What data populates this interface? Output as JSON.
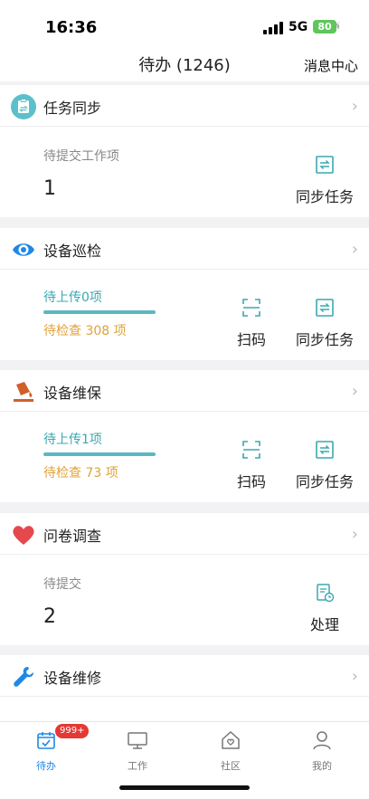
{
  "status": {
    "time": "16:36",
    "network": "5G",
    "battery": "80"
  },
  "nav": {
    "title": "待办 (1246)",
    "right": "消息中心"
  },
  "sections": {
    "task_sync": {
      "title": "任务同步",
      "label": "待提交工作项",
      "count": "1",
      "action": "同步任务"
    },
    "inspection": {
      "title": "设备巡检",
      "pending": "待上传0项",
      "check": "待检查 308 项",
      "scan": "扫码",
      "action": "同步任务",
      "progress": 1.0
    },
    "maintenance": {
      "title": "设备维保",
      "pending": "待上传1项",
      "check": "待检查 73 项",
      "scan": "扫码",
      "action": "同步任务",
      "progress": 1.0
    },
    "survey": {
      "title": "问卷调查",
      "label": "待提交",
      "count": "2",
      "action": "处理"
    },
    "repair": {
      "title": "设备维修"
    }
  },
  "tabs": [
    {
      "label": "待办",
      "badge": "999+"
    },
    {
      "label": "工作"
    },
    {
      "label": "社区"
    },
    {
      "label": "我的"
    }
  ],
  "colors": {
    "accent": "#1e88e5",
    "teal": "#5bb8c2",
    "orange": "#e0a23a",
    "badge": "#e53935"
  }
}
